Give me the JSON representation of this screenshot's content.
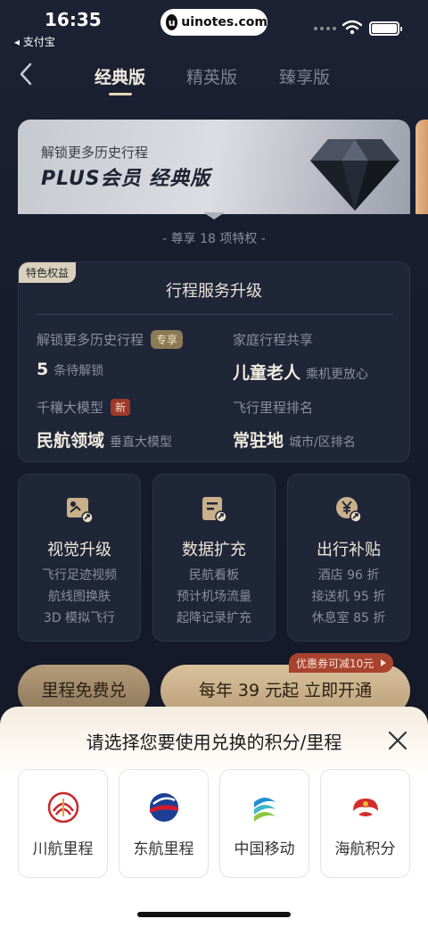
{
  "status_bar": {
    "time": "16:35",
    "back_app": "◂ 支付宝",
    "url": "uinotes.com"
  },
  "nav": {
    "tabs": [
      {
        "label": "经典版",
        "active": true
      },
      {
        "label": "精英版",
        "active": false
      },
      {
        "label": "臻享版",
        "active": false
      }
    ]
  },
  "hero": {
    "subtitle": "解锁更多历史行程",
    "title": "PLUS会员 经典版"
  },
  "perks_count": "- 尊享 18 项特权 -",
  "itinerary_panel": {
    "badge": "特色权益",
    "title": "行程服务升级",
    "cells": [
      {
        "label": "解锁更多历史行程",
        "tag": "专享",
        "value": "5",
        "note": "条待解锁"
      },
      {
        "label": "家庭行程共享",
        "tag": "",
        "value": "儿童老人",
        "note": "乘机更放心"
      },
      {
        "label": "千穰大模型",
        "tag": "新",
        "value": "民航领域",
        "note": "垂直大模型"
      },
      {
        "label": "飞行里程排名",
        "tag": "",
        "value": "常驻地",
        "note": "城市/区排名"
      }
    ]
  },
  "feature_cards": [
    {
      "icon": "video-upgrade-icon",
      "title": "视觉升级",
      "lines": [
        "飞行足迹视频",
        "航线图换肤",
        "3D 模拟飞行"
      ]
    },
    {
      "icon": "data-expand-icon",
      "title": "数据扩充",
      "lines": [
        "民航看板",
        "预计机场流量",
        "起降记录扩充"
      ]
    },
    {
      "icon": "yen-coupon-icon",
      "title": "出行补贴",
      "lines": [
        "酒店 96 折",
        "接送机 95 折",
        "休息室 85 折"
      ]
    }
  ],
  "actions": {
    "miles_label": "里程免费兑",
    "open_label": "每年 39 元起  立即开通",
    "coupon": "优惠券可减10元"
  },
  "sheet": {
    "title": "请选择您要使用兑换的积分/里程",
    "options": [
      {
        "label": "川航里程",
        "logo": "sichuan-airlines-logo"
      },
      {
        "label": "东航里程",
        "logo": "china-eastern-logo"
      },
      {
        "label": "中国移动",
        "logo": "china-mobile-logo"
      },
      {
        "label": "海航积分",
        "logo": "hainan-airlines-logo"
      }
    ]
  },
  "colors": {
    "background": "#141a2a",
    "gold": "#d9c19c",
    "coupon_red": "#a8432f"
  }
}
